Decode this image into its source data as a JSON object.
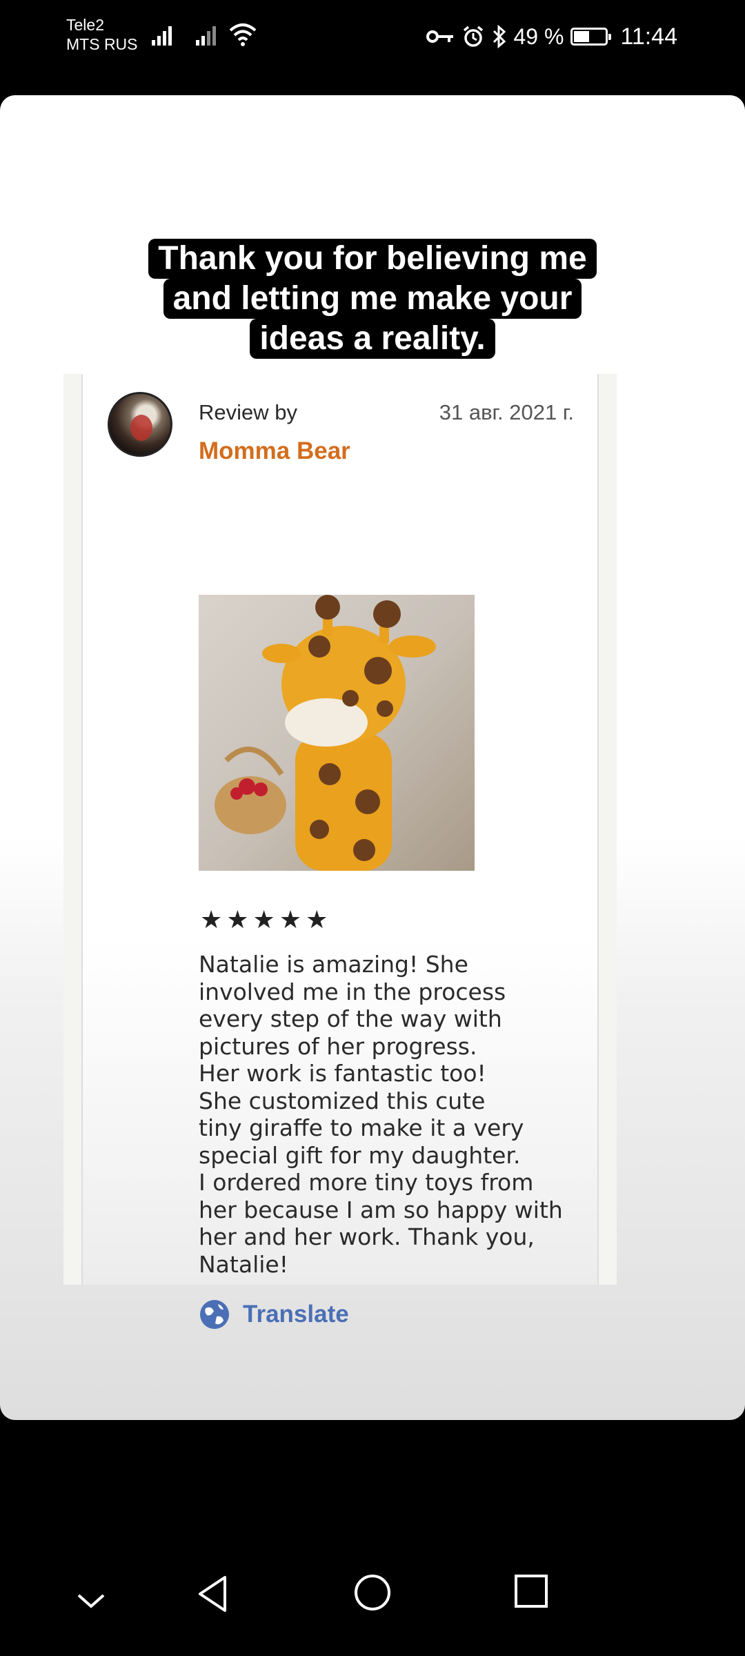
{
  "status_bar": {
    "carrier_1": "Tele2",
    "carrier_2": "MTS RUS",
    "battery": "49 %",
    "battery_level": 0.49,
    "time": "11:44",
    "icons": [
      "signal-icon",
      "signal-icon",
      "wifi-icon",
      "vpn-key-icon",
      "alarm-icon",
      "bluetooth-icon",
      "battery-icon"
    ]
  },
  "story": {
    "caption_lines": [
      "Thank you for believing me",
      "and letting me make your",
      "ideas a reality."
    ]
  },
  "review": {
    "review_by_label": "Review by",
    "author": "Momma Bear",
    "date": "31 авг. 2021 г.",
    "rating": 5,
    "stars_text": "★★★★★",
    "text": "Natalie is amazing! She\ninvolved me in the process\nevery step of the way with\npictures of her progress.\nHer work is fantastic too!\nShe customized this cute\ntiny giraffe to make it a very\nspecial gift for my daughter.\nI ordered more tiny toys from\nher because I am so happy with\nher and her work. Thank you,\nNatalie!",
    "translate_label": "Translate",
    "author_color": "#d36d1d",
    "link_color": "#4a6fb5"
  },
  "nav_bar": {
    "buttons": [
      "chevron-down-icon",
      "back-icon",
      "home-icon",
      "recents-icon"
    ]
  }
}
